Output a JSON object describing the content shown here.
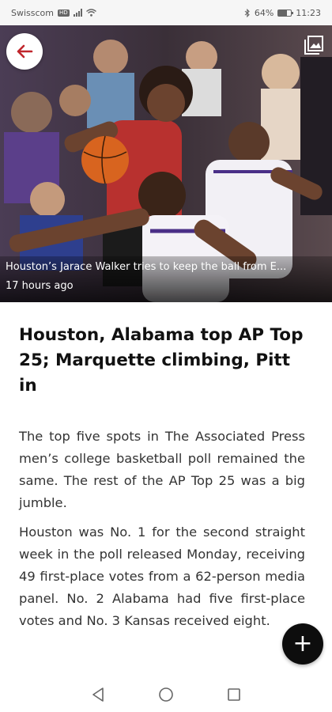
{
  "status_bar": {
    "carrier": "Swisscom",
    "network_badge": "HD",
    "battery": "64%",
    "time": "11:23",
    "icons": [
      "signal-icon",
      "wifi-icon",
      "bluetooth-icon",
      "battery-icon"
    ]
  },
  "hero": {
    "caption": "Houston’s Jarace Walker tries to keep the ball from E...",
    "timestamp": "17 hours ago",
    "back_icon": "arrow-left-icon",
    "gallery_icon": "image-gallery-icon",
    "accent_color": "#c0272d"
  },
  "article": {
    "headline": "Houston, Alabama top AP Top 25; Marquette climbing, Pitt in",
    "paragraphs": [
      "The top five spots in The Associated Press men’s college basketball poll remained the same. The rest of the AP Top 25 was a big jumble.",
      "Houston was No. 1 for the second straight week in the poll released Monday, receiving 49 first-place votes from a 62-person media panel. No. 2 Alabama had five first-place votes and No. 3 Kansas received eight."
    ]
  },
  "fab": {
    "label": "+",
    "icon": "plus-icon"
  },
  "nav_bar": {
    "icons": [
      "back-triangle-icon",
      "home-circle-icon",
      "recents-square-icon"
    ]
  }
}
